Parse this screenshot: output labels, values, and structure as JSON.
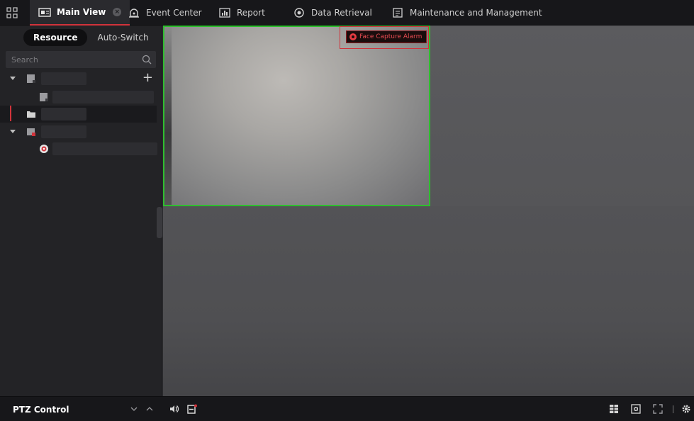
{
  "top_nav": {
    "tabs": [
      {
        "label": "Main View",
        "active": true,
        "icon": "main-view-icon"
      },
      {
        "label": "Event Center",
        "icon": "event-center-icon"
      },
      {
        "label": "Report",
        "icon": "report-icon"
      },
      {
        "label": "Data Retrieval",
        "icon": "data-retrieval-icon"
      },
      {
        "label": "Maintenance and Management",
        "icon": "maintenance-icon"
      }
    ]
  },
  "sidebar": {
    "segment": {
      "resource": "Resource",
      "auto_switch": "Auto-Switch",
      "active": "Resource"
    },
    "search": {
      "placeholder": "Search"
    }
  },
  "video": {
    "alarm_label": "Face Capture Alarm"
  },
  "bottom": {
    "ptz_label": "PTZ Control"
  },
  "colors": {
    "accent_red": "#d1333b",
    "alarm_text": "#e84b52",
    "active_window_border": "#2ebf2e"
  }
}
